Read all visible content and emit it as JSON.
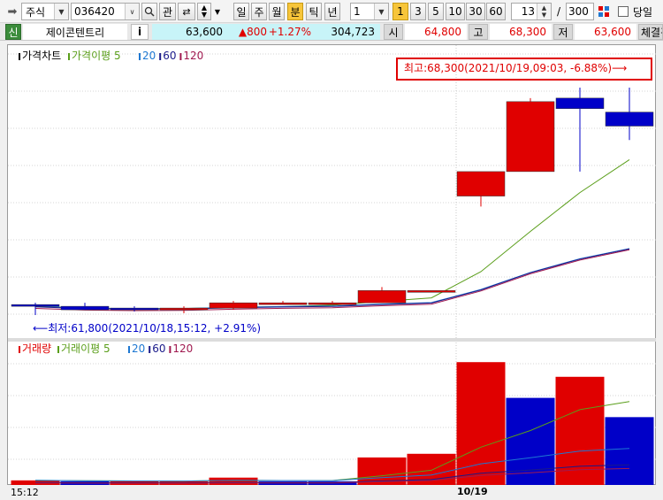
{
  "toolbar": {
    "market_select": "주식",
    "code_input": "036420",
    "gwan_label": "관",
    "periods": [
      {
        "label": "일",
        "active": false
      },
      {
        "label": "주",
        "active": false
      },
      {
        "label": "월",
        "active": false
      },
      {
        "label": "분",
        "active": true
      },
      {
        "label": "틱",
        "active": false
      },
      {
        "label": "년",
        "active": false
      }
    ],
    "interval_select": "1",
    "interval_presets": [
      "1",
      "3",
      "5",
      "10",
      "30",
      "60"
    ],
    "count_value": "13",
    "slash": "/",
    "total_value": "300",
    "same_day_label": "당일"
  },
  "quote": {
    "badge": "신",
    "name": "제이콘텐트리",
    "info_label": "i",
    "price": "63,600",
    "change": "▲800",
    "change_pct": "+1.27%",
    "volume": "304,723",
    "open_label": "시",
    "open": "64,800",
    "high_label": "고",
    "high": "68,300",
    "low_label": "저",
    "low": "63,600",
    "trade_label": "체결강"
  },
  "colors": {
    "up": "#e00000",
    "down": "#0000c8",
    "ma5": "#5a9e1a",
    "ma20": "#1e78d2",
    "ma60": "#1a1a8a",
    "ma120": "#a01a50"
  },
  "price_panel": {
    "legend": [
      {
        "text": "가격차트",
        "color": "#000000"
      },
      {
        "text": "가격이평 5",
        "color": "#5a9e1a"
      },
      {
        "text": "20",
        "color": "#1e78d2"
      },
      {
        "text": "60",
        "color": "#1a1a8a"
      },
      {
        "text": "120",
        "color": "#a01a50"
      }
    ],
    "high_note": "최고:68,300(2021/10/19,09:03, -6.88%)⟶",
    "low_note": "⟵최저:61,800(2021/10/18,15:12, +2.91%)"
  },
  "volume_panel": {
    "legend": [
      {
        "text": "거래량",
        "color": "#e00000"
      },
      {
        "text": "거래이평 5",
        "color": "#5a9e1a"
      },
      {
        "text": "20",
        "color": "#1e78d2"
      },
      {
        "text": "60",
        "color": "#1a1a8a"
      },
      {
        "text": "120",
        "color": "#a01a50"
      }
    ]
  },
  "xaxis": {
    "left_label": "15:12",
    "date_label": "10/19"
  },
  "chart_data": {
    "type": "candlestick",
    "ylim": [
      61800,
      68300
    ],
    "candles": [
      {
        "open": 62100,
        "high": 62150,
        "low": 61800,
        "close": 62050
      },
      {
        "open": 62050,
        "high": 62150,
        "low": 61950,
        "close": 61950
      },
      {
        "open": 62000,
        "high": 62050,
        "low": 61900,
        "close": 61950
      },
      {
        "open": 61950,
        "high": 62050,
        "low": 61850,
        "close": 62000
      },
      {
        "open": 62000,
        "high": 62200,
        "low": 61950,
        "close": 62150
      },
      {
        "open": 62150,
        "high": 62200,
        "low": 62150,
        "close": 62150
      },
      {
        "open": 62150,
        "high": 62200,
        "low": 62150,
        "close": 62150
      },
      {
        "open": 62150,
        "high": 62600,
        "low": 62150,
        "close": 62500
      },
      {
        "open": 62500,
        "high": 62500,
        "low": 62500,
        "close": 62500
      },
      {
        "open": 65200,
        "high": 65700,
        "low": 64900,
        "close": 65900
      },
      {
        "open": 65900,
        "high": 68000,
        "low": 65900,
        "close": 67900
      },
      {
        "open": 68000,
        "high": 68300,
        "low": 65900,
        "close": 67700
      },
      {
        "open": 67600,
        "high": 68300,
        "low": 66800,
        "close": 67200
      }
    ],
    "volumes": [
      {
        "value": 5,
        "dir": "up"
      },
      {
        "value": 4,
        "dir": "down"
      },
      {
        "value": 4,
        "dir": "up"
      },
      {
        "value": 4,
        "dir": "up"
      },
      {
        "value": 8,
        "dir": "up"
      },
      {
        "value": 4,
        "dir": "down"
      },
      {
        "value": 4,
        "dir": "down"
      },
      {
        "value": 30,
        "dir": "up"
      },
      {
        "value": 34,
        "dir": "up"
      },
      {
        "value": 134,
        "dir": "up"
      },
      {
        "value": 95,
        "dir": "down"
      },
      {
        "value": 118,
        "dir": "up"
      },
      {
        "value": 74,
        "dir": "down"
      }
    ],
    "volume_ylim": [
      0,
      140
    ]
  }
}
